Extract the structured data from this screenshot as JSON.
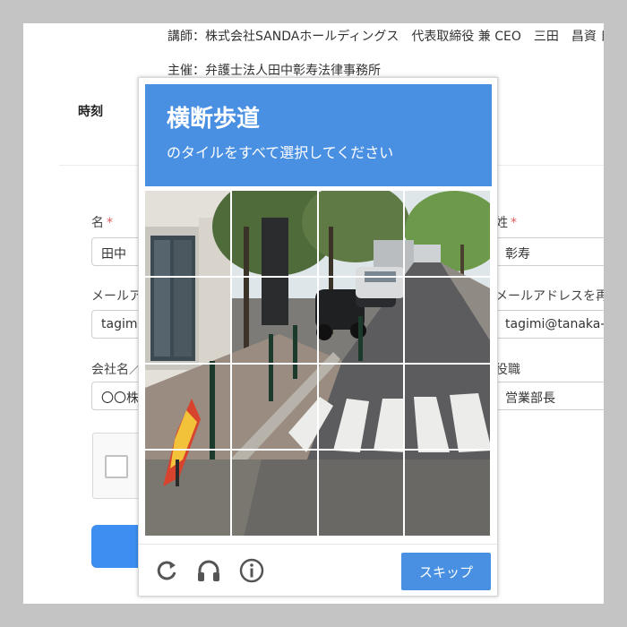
{
  "event": {
    "lecturer": "講師：株式会社SANDAホールディングス　代表取締役 兼 CEO　三田　昌資 氏",
    "organizer": "主催：弁護士法人田中彰寿法律事務所"
  },
  "table": {
    "time_label": "時刻"
  },
  "form": {
    "first_name": {
      "label": "名",
      "required": "*",
      "value": "田中"
    },
    "last_name": {
      "label": "姓",
      "required": "*",
      "value": "彰寿"
    },
    "email": {
      "label": "メールアドレス",
      "value": "tagimi@tanaka-law.jp"
    },
    "email_confirm": {
      "label": "メールアドレスを再入力",
      "value": "tagimi@tanaka-law.jp"
    },
    "company": {
      "label": "会社名／団体名",
      "value": "〇〇株式会社"
    },
    "position": {
      "label": "役職",
      "value": "営業部長"
    }
  },
  "captcha": {
    "title": "横断歩道",
    "instruction": "のタイルをすべて選択してください",
    "grid_size": 4,
    "skip_label": "スキップ",
    "icons": [
      "reload-icon",
      "headphones-icon",
      "info-icon"
    ]
  },
  "colors": {
    "accent": "#4a90e2",
    "button": "#3d8ef0",
    "required": "#e25b5b"
  }
}
